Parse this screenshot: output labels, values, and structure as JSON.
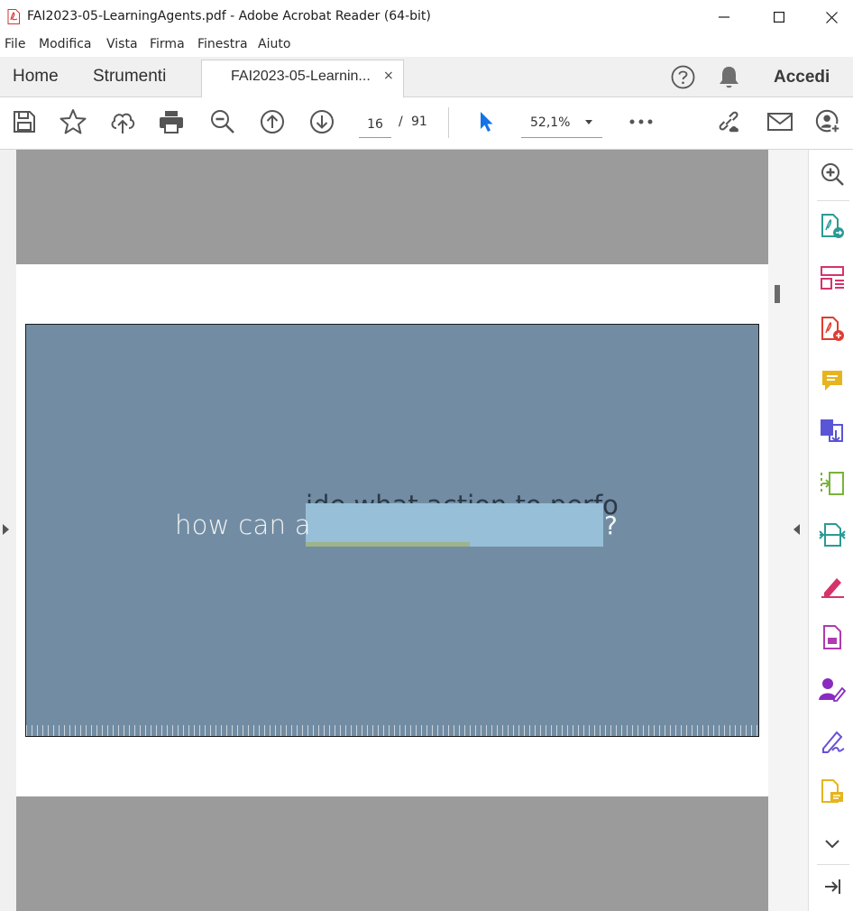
{
  "window": {
    "title": "FAI2023-05-LearningAgents.pdf - Adobe Acrobat Reader (64-bit)"
  },
  "menu": [
    "File",
    "Modifica",
    "Vista",
    "Firma",
    "Finestra",
    "Aiuto"
  ],
  "tabs": {
    "home": "Home",
    "tools": "Strumenti",
    "document": "FAI2023-05-Learnin...",
    "close": "×",
    "signin": "Accedi"
  },
  "toolbar": {
    "page_current": "16",
    "page_separator": "/",
    "page_total": "91",
    "zoom": "52,1%"
  },
  "slide": {
    "text_prefix": "how can a",
    "ghost_text": "ide what action to perfo",
    "text_suffix": "?"
  },
  "colors": {
    "slide_bg": "#728da3",
    "highlight": "#97bfd8",
    "green": "#9eb38b",
    "accent_blue": "#1473e6"
  },
  "icons": {
    "toolbar": [
      "save-icon",
      "star-icon",
      "upload-cloud-icon",
      "print-icon",
      "zoom-out-icon",
      "page-up-icon",
      "page-down-icon",
      "select-cursor-icon",
      "more-icon",
      "share-link-icon",
      "email-icon",
      "add-user-icon"
    ],
    "rail": [
      "zoom-icon",
      "export-pdf-icon",
      "organize-pages-icon",
      "create-pdf-icon",
      "comment-icon",
      "combine-files-icon",
      "compress-icon",
      "scan-icon",
      "fill-sign-icon",
      "protect-icon",
      "request-signature-icon",
      "sign-icon",
      "stamp-icon",
      "expand-more-icon",
      "collapse-panel-icon"
    ]
  }
}
